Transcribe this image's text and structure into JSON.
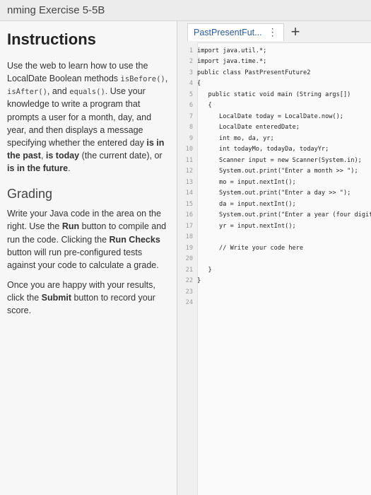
{
  "window": {
    "title": "nming Exercise 5-5B"
  },
  "instructions": {
    "heading": "Instructions",
    "p1_a": "Use the web to learn how to use the LocalDate Boolean methods ",
    "p1_isBefore": "isBefore()",
    "p1_b": ", ",
    "p1_isAfter": "isAfter()",
    "p1_c": ", and ",
    "p1_equals": "equals()",
    "p1_d": ". Use your knowledge to write a program that prompts a user for a month, day, and year, and then displays a message specifying whether the entered day ",
    "p1_is_past": "is in the past",
    "p1_e": ", ",
    "p1_is_today": "is today",
    "p1_f": " (the current date), or ",
    "p1_is_future": "is in the future",
    "p1_g": ".",
    "grading_heading": "Grading",
    "p2_a": "Write your Java code in the area on the right. Use the ",
    "p2_run": "Run",
    "p2_b": " button to compile and run the code. Clicking the ",
    "p2_run_checks": "Run Checks",
    "p2_c": " button will run pre-configured tests against your code to calculate a grade.",
    "p3_a": "Once you are happy with your results, click the ",
    "p3_submit": "Submit",
    "p3_b": " button to record your score."
  },
  "editor": {
    "tab_label": "PastPresentFut...",
    "tab_menu": "⋮",
    "add_tab": "+",
    "lines": [
      {
        "n": "1",
        "t": "import java.util.*;"
      },
      {
        "n": "2",
        "t": "import java.time.*;"
      },
      {
        "n": "3",
        "t": "public class PastPresentFuture2"
      },
      {
        "n": "4",
        "t": "{"
      },
      {
        "n": "5",
        "t": "   public static void main (String args[])"
      },
      {
        "n": "6",
        "t": "   {"
      },
      {
        "n": "7",
        "t": "      LocalDate today = LocalDate.now();"
      },
      {
        "n": "8",
        "t": "      LocalDate enteredDate;"
      },
      {
        "n": "9",
        "t": "      int mo, da, yr;"
      },
      {
        "n": "10",
        "t": "      int todayMo, todayDa, todayYr;"
      },
      {
        "n": "11",
        "t": "      Scanner input = new Scanner(System.in);"
      },
      {
        "n": "12",
        "t": "      System.out.print(\"Enter a month >> \");"
      },
      {
        "n": "13",
        "t": "      mo = input.nextInt();"
      },
      {
        "n": "14",
        "t": "      System.out.print(\"Enter a day >> \");"
      },
      {
        "n": "15",
        "t": "      da = input.nextInt();"
      },
      {
        "n": "16",
        "t": "      System.out.print(\"Enter a year (four digits) >> \");"
      },
      {
        "n": "17",
        "t": "      yr = input.nextInt();"
      },
      {
        "n": "18",
        "t": ""
      },
      {
        "n": "19",
        "t": "      // Write your code here"
      },
      {
        "n": "20",
        "t": ""
      },
      {
        "n": "21",
        "t": "   }"
      },
      {
        "n": "22",
        "t": "}"
      },
      {
        "n": "23",
        "t": ""
      },
      {
        "n": "24",
        "t": ""
      }
    ]
  }
}
